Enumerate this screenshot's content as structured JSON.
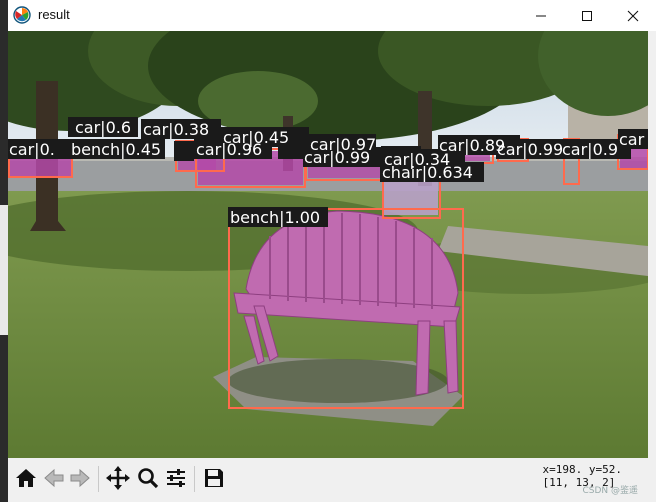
{
  "window": {
    "title": "result"
  },
  "icons": {
    "app": "matplotlib-icon",
    "minimize": "minimize-icon",
    "maximize": "maximize-icon",
    "close": "close-icon"
  },
  "toolbar": {
    "buttons": [
      {
        "name": "home-button",
        "icon": "home-icon"
      },
      {
        "name": "back-button",
        "icon": "arrow-left-icon"
      },
      {
        "name": "forward-button",
        "icon": "arrow-right-icon"
      },
      {
        "name": "pan-button",
        "icon": "move-icon"
      },
      {
        "name": "zoom-button",
        "icon": "zoom-icon"
      },
      {
        "name": "configure-subplots-button",
        "icon": "sliders-icon"
      },
      {
        "name": "save-button",
        "icon": "save-icon"
      }
    ],
    "coords_line1": "x=198. y=52.",
    "coords_line2": "[11, 13, 2]"
  },
  "watermark": "CSDN @鉴遥",
  "detections": {
    "labels": [
      "car|0.6",
      "car|0.38",
      "car|0.45",
      "car|0.97",
      "car|0.99",
      "car|0.34",
      "car|0.89",
      "car|0.99",
      "car|0.9",
      "car|0.",
      "car|0.96",
      "car|0.",
      "bench|0.45",
      "bench|1.00",
      "chair|0.634",
      "car|0",
      "car"
    ]
  },
  "colors": {
    "box": "#ff6a4d",
    "mask": "#b449a8",
    "label_bg": "#1a1a1a"
  }
}
